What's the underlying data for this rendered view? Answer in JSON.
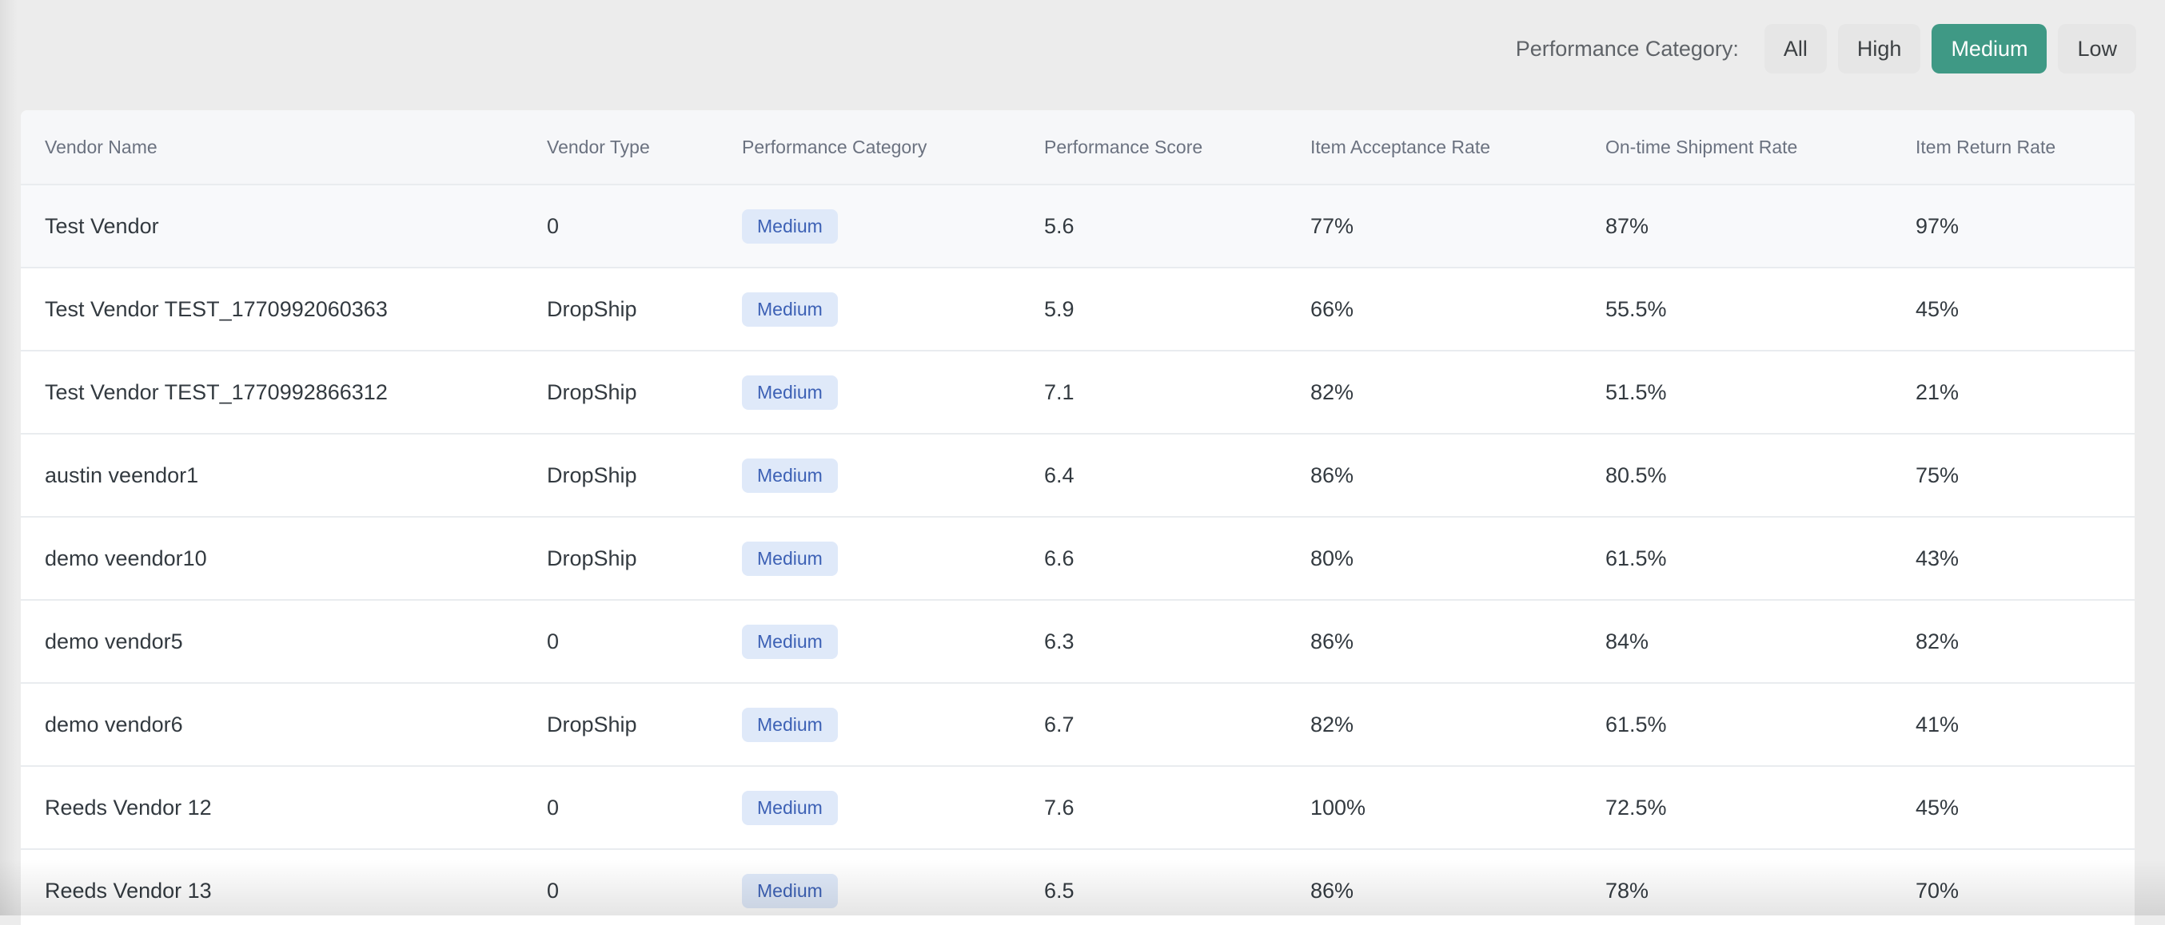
{
  "filter": {
    "label": "Performance Category:",
    "options": [
      "All",
      "High",
      "Medium",
      "Low"
    ],
    "selected": "Medium",
    "active_color": "#3f9985"
  },
  "table": {
    "columns": [
      "Vendor Name",
      "Vendor Type",
      "Performance Category",
      "Performance Score",
      "Item Acceptance Rate",
      "On-time Shipment Rate",
      "Item Return Rate"
    ],
    "rows": [
      {
        "vendor_name": "Test Vendor",
        "vendor_type": "0",
        "category": "Medium",
        "score": "5.6",
        "acceptance": "77%",
        "on_time": "87%",
        "return_rate": "97%"
      },
      {
        "vendor_name": "Test Vendor TEST_1770992060363",
        "vendor_type": "DropShip",
        "category": "Medium",
        "score": "5.9",
        "acceptance": "66%",
        "on_time": "55.5%",
        "return_rate": "45%"
      },
      {
        "vendor_name": "Test Vendor TEST_1770992866312",
        "vendor_type": "DropShip",
        "category": "Medium",
        "score": "7.1",
        "acceptance": "82%",
        "on_time": "51.5%",
        "return_rate": "21%"
      },
      {
        "vendor_name": "austin veendor1",
        "vendor_type": "DropShip",
        "category": "Medium",
        "score": "6.4",
        "acceptance": "86%",
        "on_time": "80.5%",
        "return_rate": "75%"
      },
      {
        "vendor_name": "demo veendor10",
        "vendor_type": "DropShip",
        "category": "Medium",
        "score": "6.6",
        "acceptance": "80%",
        "on_time": "61.5%",
        "return_rate": "43%"
      },
      {
        "vendor_name": "demo vendor5",
        "vendor_type": "0",
        "category": "Medium",
        "score": "6.3",
        "acceptance": "86%",
        "on_time": "84%",
        "return_rate": "82%"
      },
      {
        "vendor_name": "demo vendor6",
        "vendor_type": "DropShip",
        "category": "Medium",
        "score": "6.7",
        "acceptance": "82%",
        "on_time": "61.5%",
        "return_rate": "41%"
      },
      {
        "vendor_name": "Reeds Vendor 12",
        "vendor_type": "0",
        "category": "Medium",
        "score": "7.6",
        "acceptance": "100%",
        "on_time": "72.5%",
        "return_rate": "45%"
      },
      {
        "vendor_name": "Reeds Vendor 13",
        "vendor_type": "0",
        "category": "Medium",
        "score": "6.5",
        "acceptance": "86%",
        "on_time": "78%",
        "return_rate": "70%"
      }
    ]
  }
}
